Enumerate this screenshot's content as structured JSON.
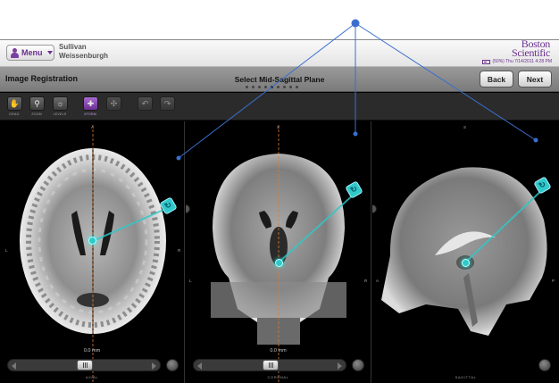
{
  "header": {
    "menu_label": "Menu",
    "patient_first": "Sullivan",
    "patient_last": "Weissenburgh",
    "brand_line1": "Boston",
    "brand_line2": "Scientific",
    "status": "(50%) Thu 7/14/2011 4:28 PM",
    "battery_level": 0.5
  },
  "titlebar": {
    "title": "Image Registration",
    "step_title": "Select Mid-Sagittal Plane",
    "back_label": "Back",
    "next_label": "Next",
    "steps_total": 9,
    "step_active": 5
  },
  "toolbar": {
    "tools": [
      {
        "name": "drag",
        "label": "DRAG",
        "icon": "hand-icon"
      },
      {
        "name": "zoom",
        "label": "ZOOM",
        "icon": "magnifier-icon"
      },
      {
        "name": "levels",
        "label": "LEVELS",
        "icon": "brightness-icon"
      },
      {
        "name": "xform",
        "label": "XFORM",
        "icon": "move-icon",
        "active": true
      },
      {
        "name": "crosshair",
        "label": "",
        "icon": "crosshair-icon",
        "disabled": true
      },
      {
        "name": "undo",
        "label": "",
        "icon": "undo-icon",
        "disabled": true
      },
      {
        "name": "redo",
        "label": "",
        "icon": "redo-icon",
        "disabled": true
      }
    ]
  },
  "viewports": {
    "axial": {
      "name": "AXIAL",
      "readout": "0.0 mm",
      "top": "A",
      "left": "L",
      "right": "R",
      "slider_pos": 0.5
    },
    "coronal": {
      "name": "CORONAL",
      "readout": "0.0 mm",
      "top": "S",
      "left": "L",
      "right": "R",
      "slider_pos": 0.5
    },
    "sagittal": {
      "name": "SAGITTAL",
      "readout": "",
      "top": "S",
      "left": "A",
      "right": "P"
    }
  },
  "colors": {
    "accent": "#6a2f8e",
    "handle": "#2fc9c9",
    "annotation": "#3a6fcf"
  }
}
